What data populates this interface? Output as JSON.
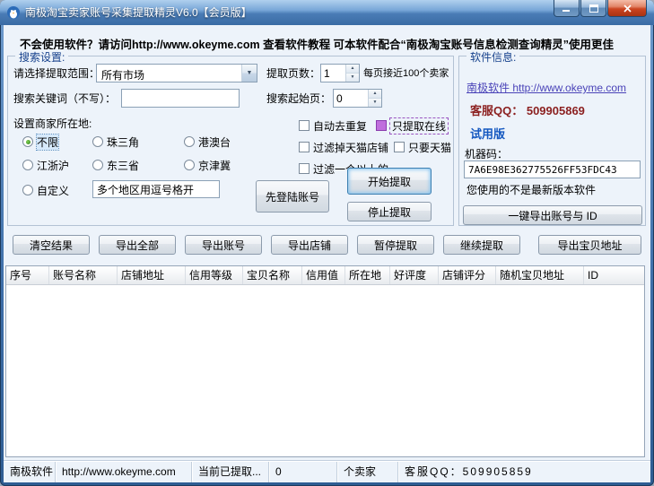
{
  "colors": {
    "titlebar_blue": "#4a7cb6",
    "client_background": "#edf3fa",
    "online_checkbox_purple": "#c06fdd",
    "link_purple": "#4a43b8",
    "qq_dark_red": "#8b1f1f",
    "trial_blue": "#1558c0",
    "default_button_glow": "#7fc1ef"
  },
  "window": {
    "title": "南极淘宝卖家账号采集提取精灵V6.0【会员版】"
  },
  "notice": "不会使用软件？请访问http://www.okeyme.com 查看软件教程 可本软件配合“南极淘宝账号信息检测查询精灵”使用更佳",
  "search_settings": {
    "group_title": "搜索设置:",
    "range_label": "请选择提取范围：",
    "range_value": "所有市场",
    "pages_label": "提取页数：",
    "pages_value": "1",
    "pages_hint": "每页接近100个卖家",
    "keyword_label": "搜索关键词（不写）：",
    "keyword_value": "",
    "start_page_label": "搜索起始页：",
    "start_page_value": "0",
    "checkboxes": [
      {
        "label": "自动去重复",
        "checked": false
      },
      {
        "label": "只提取在线",
        "checked": true
      },
      {
        "label": "过滤掉天猫店铺",
        "checked": false
      },
      {
        "label": "只要天猫",
        "checked": false
      },
      {
        "label": "过滤一个以上的",
        "checked": false
      }
    ],
    "location_label": "设置商家所在地:",
    "radios": [
      {
        "label": "不限",
        "selected": true
      },
      {
        "label": "珠三角",
        "selected": false
      },
      {
        "label": "港澳台",
        "selected": false
      },
      {
        "label": "江浙沪",
        "selected": false
      },
      {
        "label": "东三省",
        "selected": false
      },
      {
        "label": "京津冀",
        "selected": false
      },
      {
        "label": "自定义",
        "selected": false
      }
    ],
    "custom_area_value": "多个地区用逗号格开",
    "login_button": "先登陆账号",
    "start_button": "开始提取",
    "stop_button": "停止提取"
  },
  "software_info": {
    "group_title": "软件信息:",
    "link": "南极软件 http://www.okeyme.com",
    "qq": "客服QQ： 509905869",
    "trial": "试用版",
    "machine_label": "机器码：",
    "machine_code": "7A6E98E362775526FF53FDC43",
    "version_note": "您使用的不是最新版本软件",
    "export_id_button": "一键导出账号与 ID"
  },
  "action_buttons": [
    "清空结果",
    "导出全部",
    "导出账号",
    "导出店铺",
    "暂停提取",
    "继续提取",
    "导出宝贝地址"
  ],
  "table": {
    "columns": [
      "序号",
      "账号名称",
      "店铺地址",
      "信用等级",
      "宝贝名称",
      "信用值",
      "所在地",
      "好评度",
      "店铺评分",
      "随机宝贝地址",
      "ID"
    ]
  },
  "status_bar": {
    "cells": [
      "南极软件",
      "http://www.okeyme.com",
      "当前已提取...",
      "0",
      "个卖家",
      "客服QQ：509905859"
    ]
  }
}
